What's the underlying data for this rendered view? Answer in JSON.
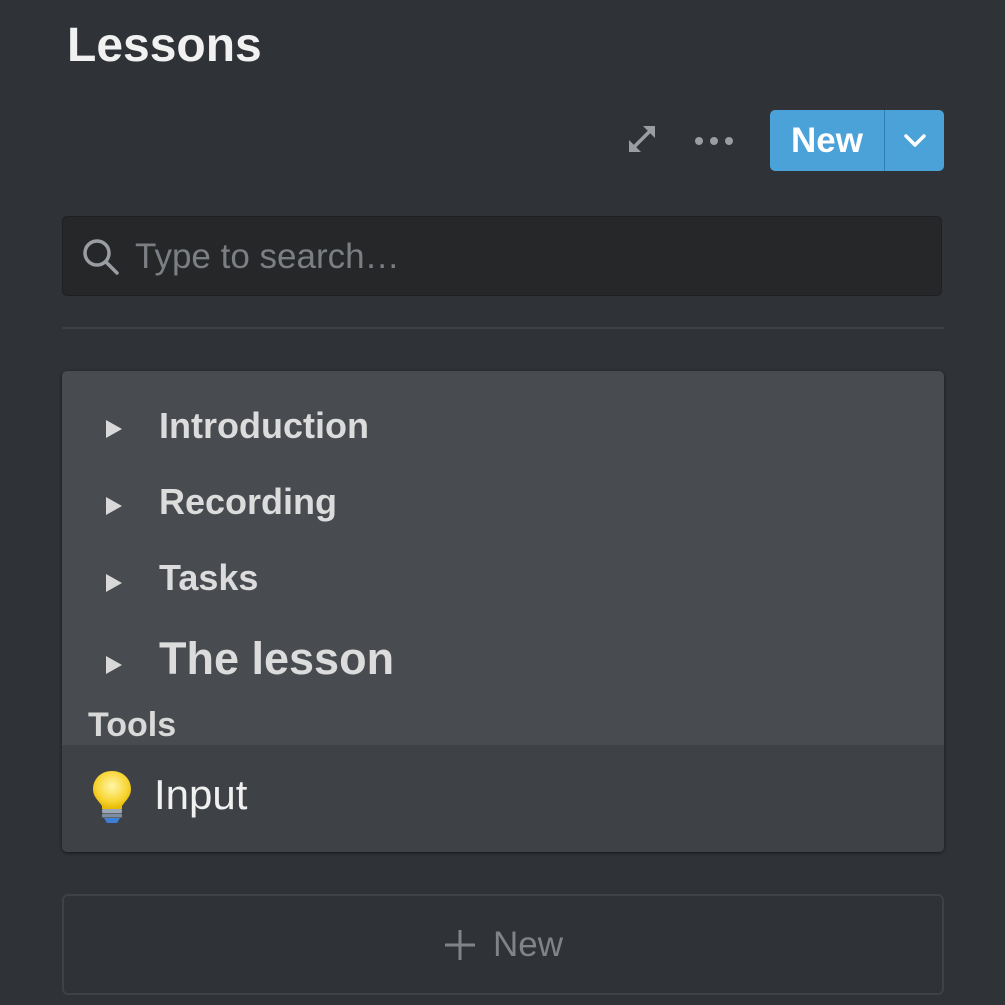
{
  "page": {
    "title": "Lessons"
  },
  "toolbar": {
    "expand_icon": "expand-arrows-icon",
    "more_icon": "more-dots-icon",
    "new_label": "New",
    "new_dropdown_icon": "chevron-down-icon",
    "accent_color": "#4aa2d8"
  },
  "search": {
    "icon": "search-icon",
    "placeholder": "Type to search…",
    "value": ""
  },
  "card": {
    "toggles": [
      {
        "label": "Introduction"
      },
      {
        "label": "Recording"
      },
      {
        "label": "Tasks"
      },
      {
        "label": "The lesson"
      }
    ],
    "section_label": "Tools",
    "tool_item": {
      "icon": "light-bulb-icon",
      "label": "Input"
    }
  },
  "add_new": {
    "icon": "plus-icon",
    "label": "New"
  }
}
